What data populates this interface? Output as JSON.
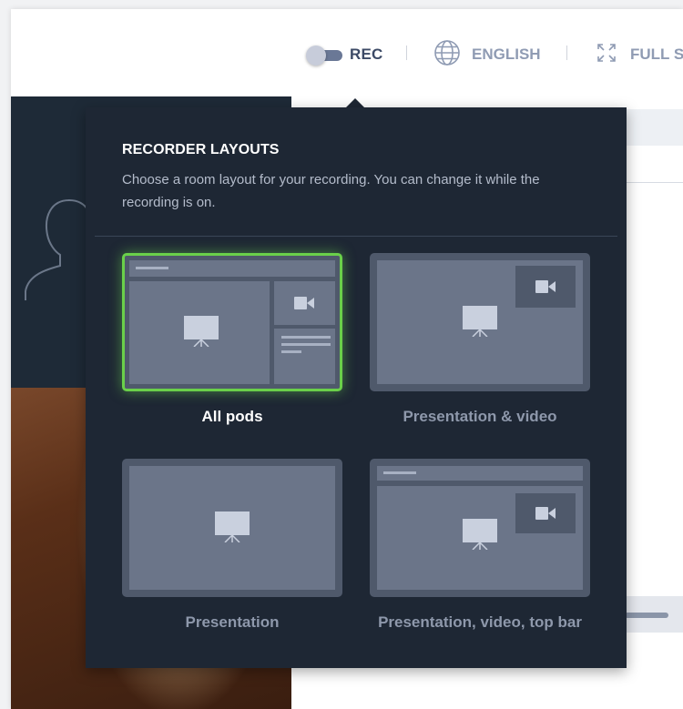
{
  "toolbar": {
    "rec_label": "REC",
    "language_label": "ENGLISH",
    "fullscreen_label": "FULL S"
  },
  "popover": {
    "title": "RECORDER LAYOUTS",
    "description": "Choose a room layout for your recording. You can change it while the recording is on."
  },
  "layouts": [
    {
      "label": "All pods",
      "selected": true
    },
    {
      "label": "Presentation & video",
      "selected": false
    },
    {
      "label": "Presentation",
      "selected": false
    },
    {
      "label": "Presentation, video, top bar",
      "selected": false
    }
  ],
  "colors": {
    "popover_bg": "#1e2734",
    "selected_border": "#6ad04a",
    "thumb_bg": "#4f596b",
    "pane": "#6b7589"
  }
}
